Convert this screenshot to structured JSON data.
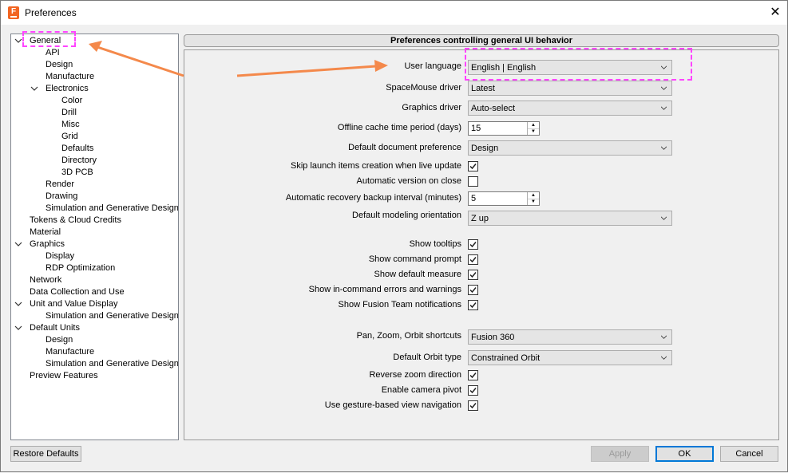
{
  "window": {
    "title": "Preferences",
    "close_symbol": "✕"
  },
  "tree": {
    "general": "General",
    "api": "API",
    "design": "Design",
    "manufacture": "Manufacture",
    "electronics": "Electronics",
    "color": "Color",
    "drill": "Drill",
    "misc": "Misc",
    "grid": "Grid",
    "defaults": "Defaults",
    "directory": "Directory",
    "pcb3d": "3D PCB",
    "render": "Render",
    "drawing": "Drawing",
    "simgen1": "Simulation and Generative Design",
    "tokens": "Tokens & Cloud Credits",
    "material": "Material",
    "graphics": "Graphics",
    "display": "Display",
    "rdp": "RDP Optimization",
    "network": "Network",
    "datacollection": "Data Collection and Use",
    "unitvalue": "Unit and Value Display",
    "simgen2": "Simulation and Generative Design",
    "defaultunits": "Default Units",
    "du_design": "Design",
    "du_manufacture": "Manufacture",
    "simgen3": "Simulation and Generative Design",
    "preview": "Preview Features"
  },
  "panel": {
    "header": "Preferences controlling general UI behavior",
    "user_language": {
      "label": "User language",
      "value": "English | English"
    },
    "spacemouse": {
      "label": "SpaceMouse driver",
      "value": "Latest"
    },
    "graphics_driver": {
      "label": "Graphics driver",
      "value": "Auto-select"
    },
    "offline_cache": {
      "label": "Offline cache time period (days)",
      "value": "15"
    },
    "default_document": {
      "label": "Default document preference",
      "value": "Design"
    },
    "skip_launch": {
      "label": "Skip launch items creation when live update",
      "checked": true
    },
    "auto_version": {
      "label": "Automatic version on close",
      "checked": false
    },
    "auto_recovery": {
      "label": "Automatic recovery backup interval (minutes)",
      "value": "5"
    },
    "modeling_orientation": {
      "label": "Default modeling orientation",
      "value": "Z up"
    },
    "show_tooltips": {
      "label": "Show tooltips",
      "checked": true
    },
    "show_command_prompt": {
      "label": "Show command prompt",
      "checked": true
    },
    "show_default_measure": {
      "label": "Show default measure",
      "checked": true
    },
    "show_incommand_errors": {
      "label": "Show in-command errors and warnings",
      "checked": true
    },
    "show_team_notifications": {
      "label": "Show Fusion Team notifications",
      "checked": true
    },
    "pan_zoom_orbit": {
      "label": "Pan, Zoom, Orbit shortcuts",
      "value": "Fusion 360"
    },
    "default_orbit": {
      "label": "Default Orbit type",
      "value": "Constrained Orbit"
    },
    "reverse_zoom": {
      "label": "Reverse zoom direction",
      "checked": true
    },
    "camera_pivot": {
      "label": "Enable camera pivot",
      "checked": true
    },
    "gesture_nav": {
      "label": "Use gesture-based view navigation",
      "checked": true
    }
  },
  "footer": {
    "restore_defaults": "Restore Defaults",
    "apply": "Apply",
    "ok": "OK",
    "cancel": "Cancel"
  },
  "colors": {
    "annotation": "#f4894b",
    "highlight": "#ff44ff",
    "accent": "#0078d7"
  }
}
